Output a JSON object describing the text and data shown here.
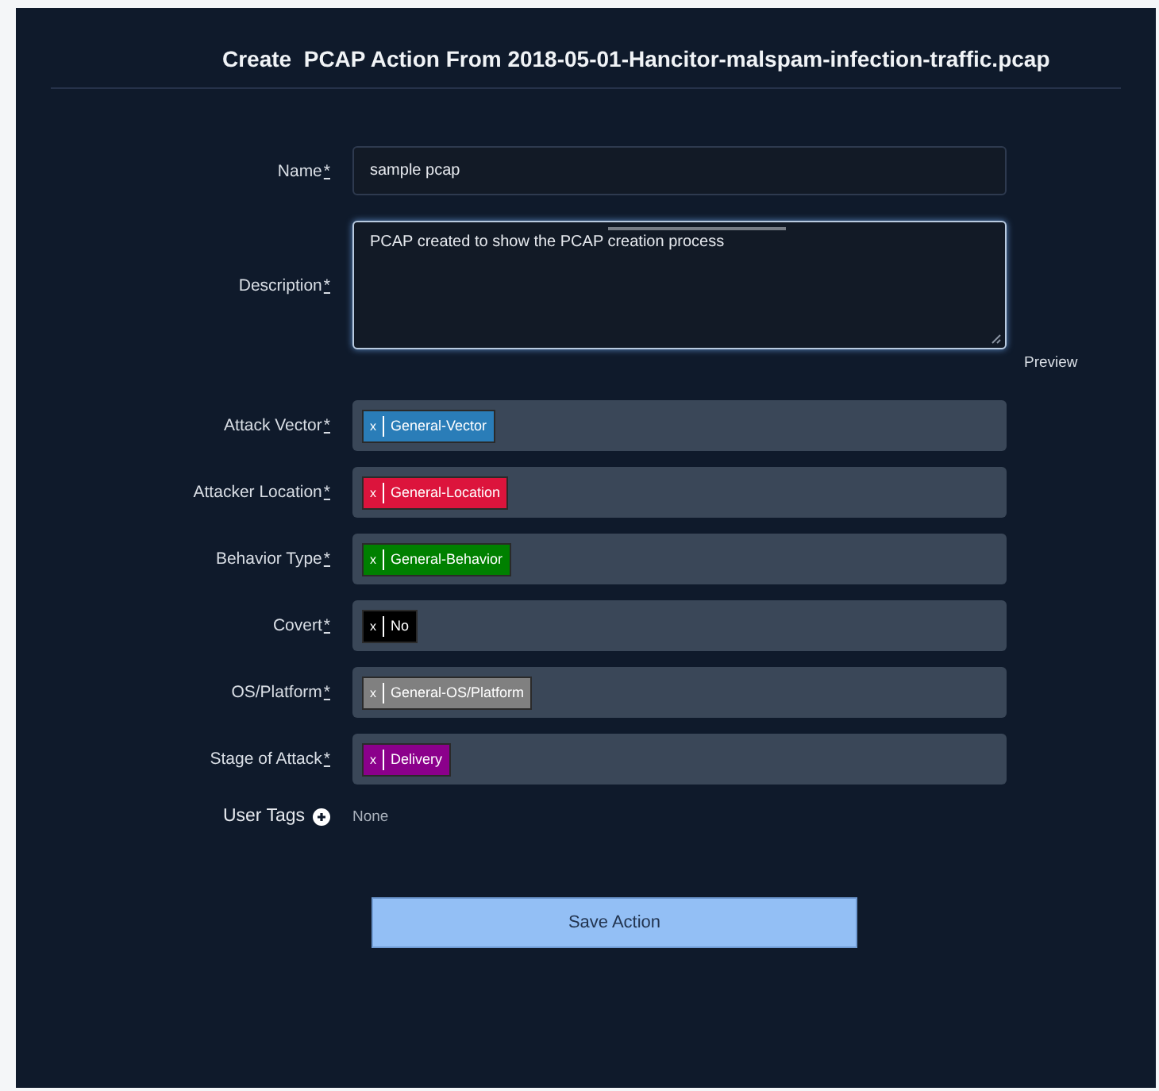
{
  "title": "Create  PCAP Action From 2018-05-01-Hancitor-malspam-infection-traffic.pcap",
  "name_field": {
    "label": "Name",
    "mark": "*",
    "value": "sample pcap"
  },
  "description_field": {
    "label": "Description",
    "mark": "*",
    "value": "PCAP created to show the PCAP creation process",
    "link": "Preview"
  },
  "tag_fields": [
    {
      "label": "Attack Vector",
      "mark": "*",
      "tags": [
        {
          "remove": "x",
          "text": "General-Vector",
          "color": "#2a7db8"
        }
      ]
    },
    {
      "label": "Attacker Location",
      "mark": "*",
      "tags": [
        {
          "remove": "x",
          "text": "General-Location",
          "color": "#dc143c"
        }
      ]
    },
    {
      "label": "Behavior Type",
      "mark": "*",
      "tags": [
        {
          "remove": "x",
          "text": "General-Behavior",
          "color": "#008000"
        }
      ]
    },
    {
      "label": "Covert",
      "mark": "*",
      "tags": [
        {
          "remove": "x",
          "text": "No",
          "color": "#000000"
        }
      ]
    },
    {
      "label": "OS/Platform",
      "mark": "*",
      "tags": [
        {
          "remove": "x",
          "text": "General-OS/Platform",
          "color": "#808080"
        }
      ]
    },
    {
      "label": "Stage of Attack",
      "mark": "*",
      "tags": [
        {
          "remove": "x",
          "text": "Delivery",
          "color": "#8b008b"
        }
      ]
    }
  ],
  "user_tags": {
    "label": "User Tags",
    "value": "None"
  },
  "save_button": "Save Action"
}
